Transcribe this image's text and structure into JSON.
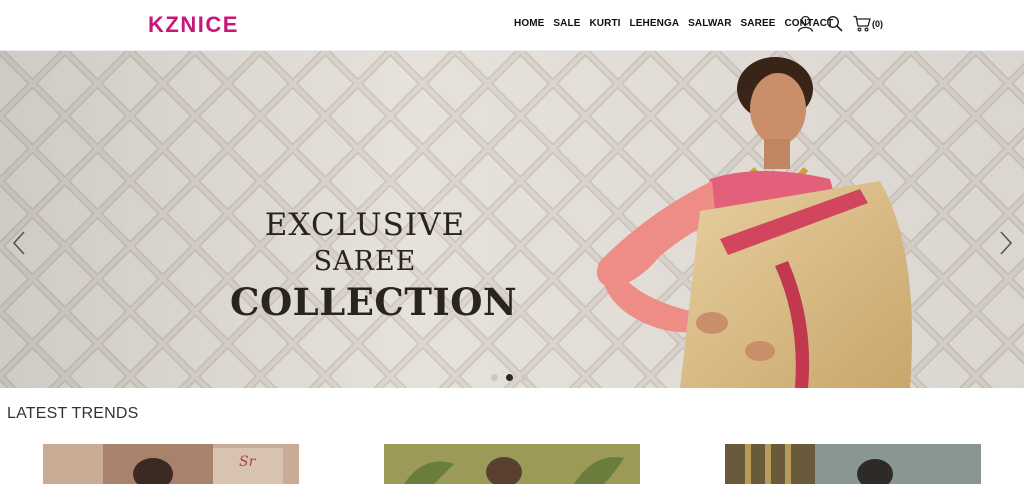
{
  "brand": {
    "logo": "KZNICE",
    "color": "#c8177a"
  },
  "nav": {
    "items": [
      "HOME",
      "SALE",
      "KURTI",
      "LEHENGA",
      "SALWAR",
      "SAREE",
      "CONTACT"
    ],
    "cart_count": "(0)",
    "icons": [
      "user-icon",
      "search-icon",
      "cart-icon"
    ]
  },
  "hero": {
    "line1": "EXCLUSIVE",
    "line2": "SAREE",
    "line3": "COLLECTION",
    "slides": 3,
    "active_slide": 2
  },
  "latest": {
    "title": "LATEST TRENDS",
    "products": [
      {
        "image": "product-image-1"
      },
      {
        "image": "product-image-2"
      },
      {
        "image": "product-image-3"
      }
    ]
  }
}
